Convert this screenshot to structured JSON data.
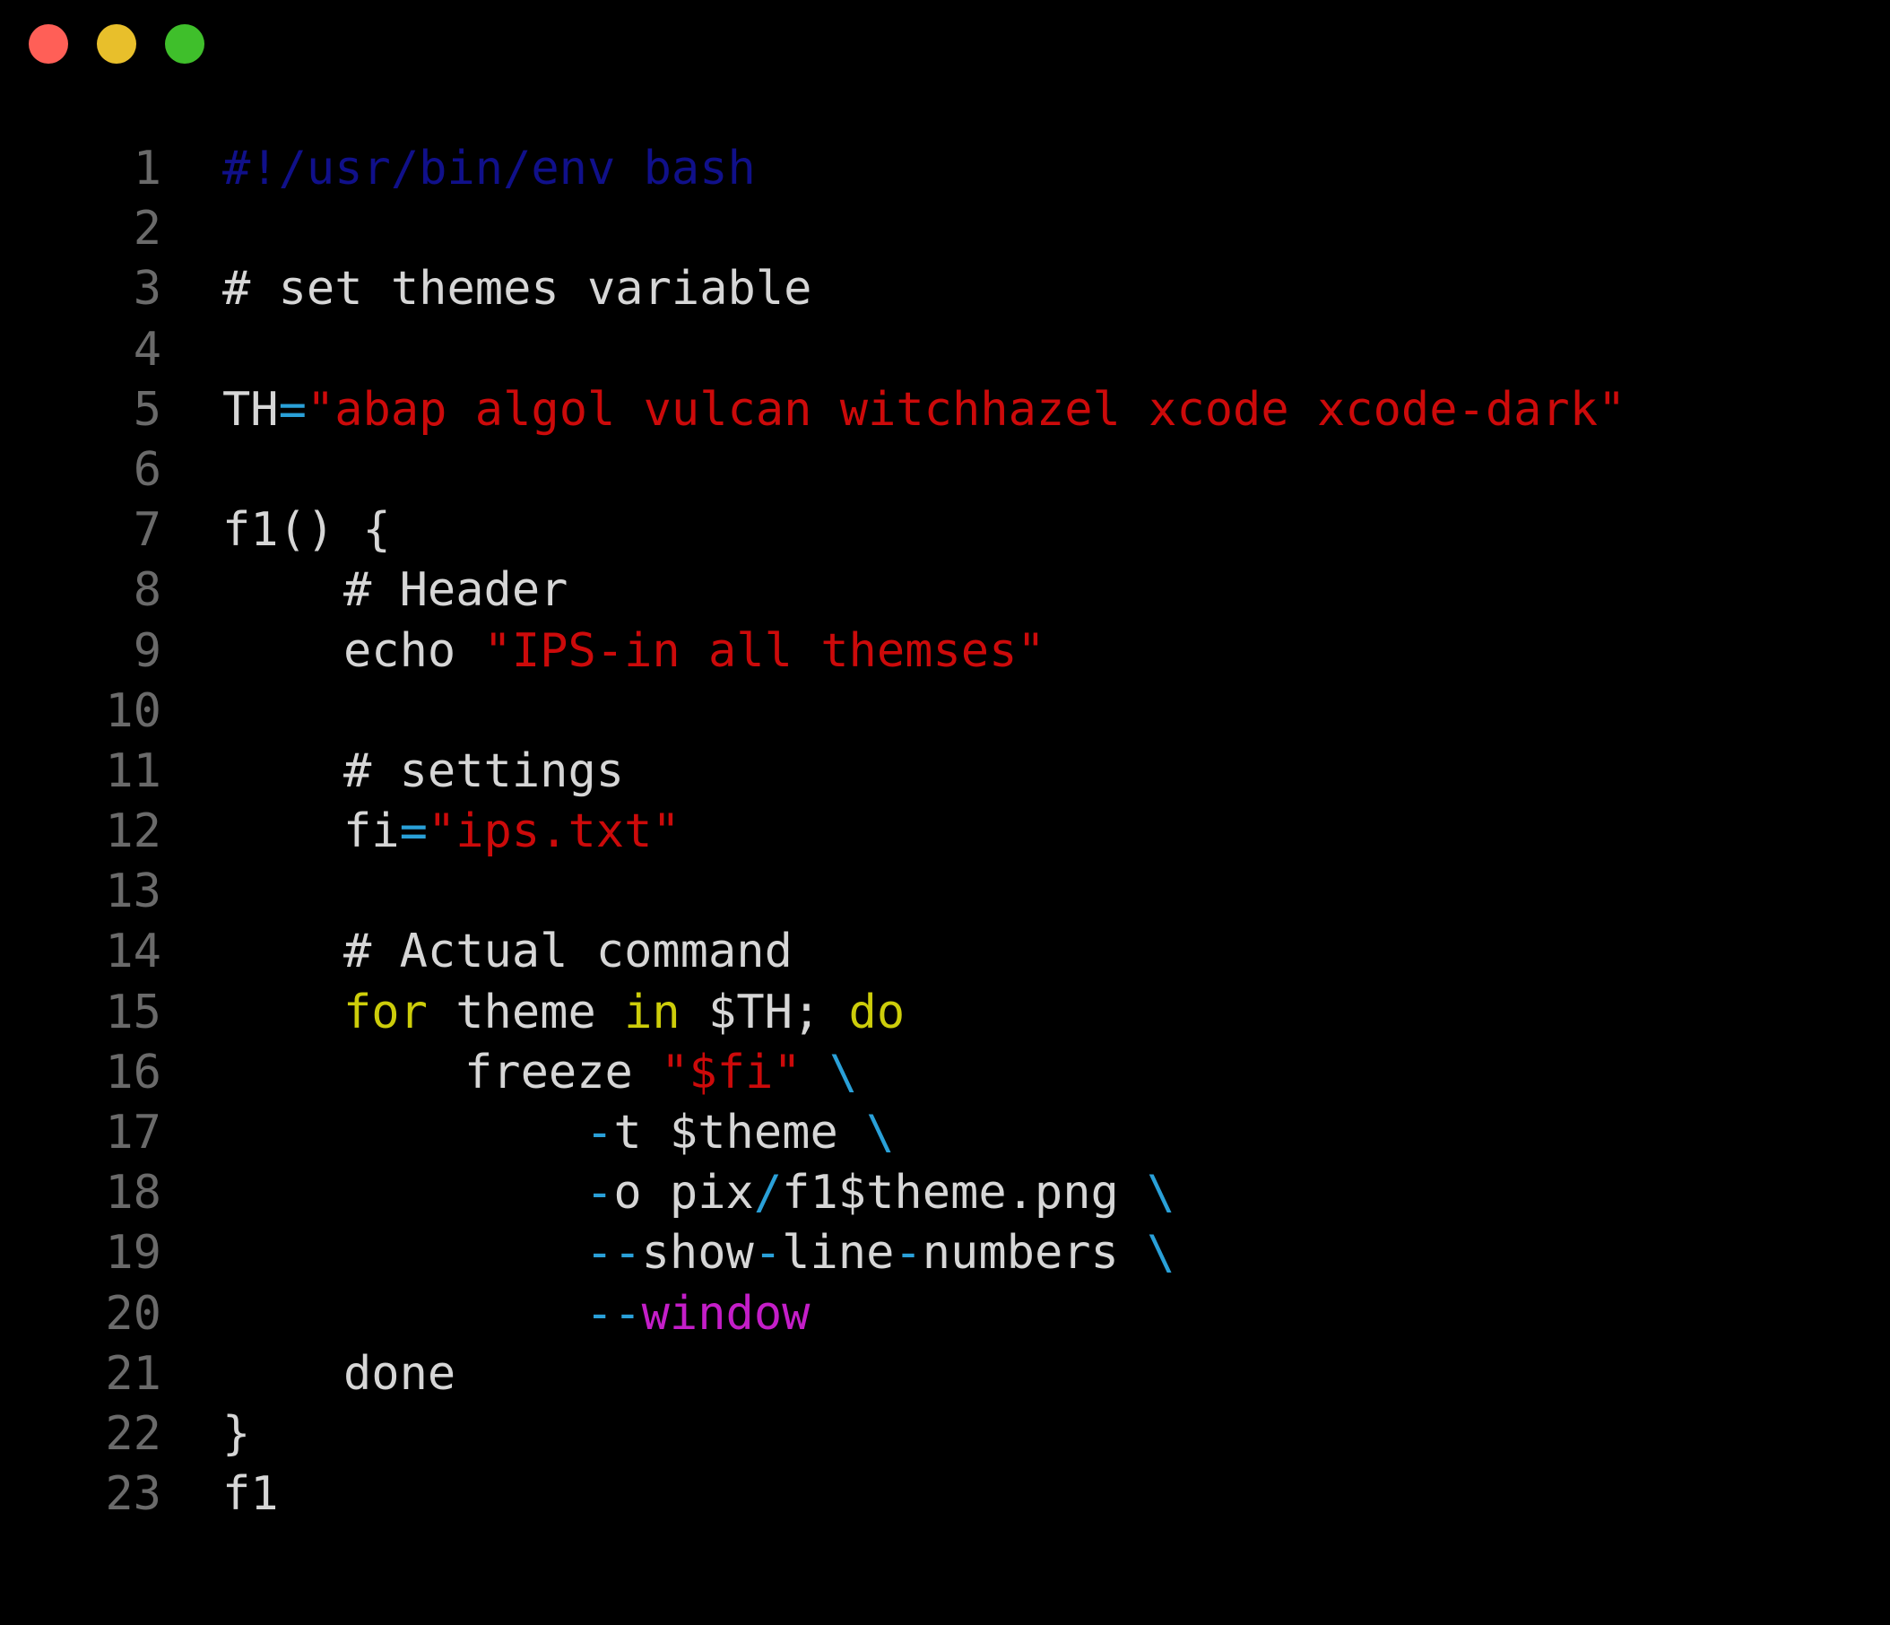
{
  "window": {
    "controls": [
      {
        "name": "close",
        "color": "#ff5f57"
      },
      {
        "name": "minimize",
        "color": "#e8bf2b"
      },
      {
        "name": "maximize",
        "color": "#3fbf2b"
      }
    ]
  },
  "theme": {
    "background": "#000000",
    "line_number": "#6a6a6a",
    "default": "#d6d6d6",
    "comment_shebang": "#10108a",
    "string": "#cc0a0a",
    "operator": "#2aa0d8",
    "keyword": "#cdcd0a",
    "option": "#c41ec8"
  },
  "lines": [
    {
      "n": "1",
      "indent": 0,
      "tokens": [
        {
          "t": "#!/usr/bin/env bash",
          "c": "comment_shebang"
        }
      ]
    },
    {
      "n": "2",
      "indent": 0,
      "tokens": []
    },
    {
      "n": "3",
      "indent": 0,
      "tokens": [
        {
          "t": "# set themes variable",
          "c": "default"
        }
      ]
    },
    {
      "n": "4",
      "indent": 0,
      "tokens": []
    },
    {
      "n": "5",
      "indent": 0,
      "tokens": [
        {
          "t": "TH",
          "c": "default"
        },
        {
          "t": "=",
          "c": "operator"
        },
        {
          "t": "\"abap algol vulcan witchhazel xcode xcode-dark\"",
          "c": "string"
        }
      ]
    },
    {
      "n": "6",
      "indent": 0,
      "tokens": []
    },
    {
      "n": "7",
      "indent": 0,
      "tokens": [
        {
          "t": "f1() {",
          "c": "default"
        }
      ]
    },
    {
      "n": "8",
      "indent": 1,
      "tokens": [
        {
          "t": "# Header",
          "c": "default"
        }
      ]
    },
    {
      "n": "9",
      "indent": 1,
      "tokens": [
        {
          "t": "echo ",
          "c": "default"
        },
        {
          "t": "\"IPS-in all themses\"",
          "c": "string"
        }
      ]
    },
    {
      "n": "10",
      "indent": 0,
      "tokens": []
    },
    {
      "n": "11",
      "indent": 1,
      "tokens": [
        {
          "t": "# settings",
          "c": "default"
        }
      ]
    },
    {
      "n": "12",
      "indent": 1,
      "tokens": [
        {
          "t": "fi",
          "c": "default"
        },
        {
          "t": "=",
          "c": "operator"
        },
        {
          "t": "\"ips.txt\"",
          "c": "string"
        }
      ]
    },
    {
      "n": "13",
      "indent": 0,
      "tokens": []
    },
    {
      "n": "14",
      "indent": 1,
      "tokens": [
        {
          "t": "# Actual command",
          "c": "default"
        }
      ]
    },
    {
      "n": "15",
      "indent": 1,
      "tokens": [
        {
          "t": "for",
          "c": "keyword"
        },
        {
          "t": " theme ",
          "c": "default"
        },
        {
          "t": "in",
          "c": "keyword"
        },
        {
          "t": " $TH; ",
          "c": "default"
        },
        {
          "t": "do",
          "c": "keyword"
        }
      ]
    },
    {
      "n": "16",
      "indent": 2,
      "tokens": [
        {
          "t": "freeze ",
          "c": "default"
        },
        {
          "t": "\"$fi\"",
          "c": "string"
        },
        {
          "t": " ",
          "c": "default"
        },
        {
          "t": "\\",
          "c": "operator"
        }
      ]
    },
    {
      "n": "17",
      "indent": 3,
      "tokens": [
        {
          "t": "-",
          "c": "operator"
        },
        {
          "t": "t $theme ",
          "c": "default"
        },
        {
          "t": "\\",
          "c": "operator"
        }
      ]
    },
    {
      "n": "18",
      "indent": 3,
      "tokens": [
        {
          "t": "-",
          "c": "operator"
        },
        {
          "t": "o pix",
          "c": "default"
        },
        {
          "t": "/",
          "c": "operator"
        },
        {
          "t": "f1$theme.png ",
          "c": "default"
        },
        {
          "t": "\\",
          "c": "operator"
        }
      ]
    },
    {
      "n": "19",
      "indent": 3,
      "tokens": [
        {
          "t": "--",
          "c": "operator"
        },
        {
          "t": "show",
          "c": "default"
        },
        {
          "t": "-",
          "c": "operator"
        },
        {
          "t": "line",
          "c": "default"
        },
        {
          "t": "-",
          "c": "operator"
        },
        {
          "t": "numbers ",
          "c": "default"
        },
        {
          "t": "\\",
          "c": "operator"
        }
      ]
    },
    {
      "n": "20",
      "indent": 3,
      "tokens": [
        {
          "t": "--",
          "c": "operator"
        },
        {
          "t": "window",
          "c": "option"
        }
      ]
    },
    {
      "n": "21",
      "indent": 1,
      "tokens": [
        {
          "t": "done",
          "c": "default"
        }
      ]
    },
    {
      "n": "22",
      "indent": 0,
      "tokens": [
        {
          "t": "}",
          "c": "default"
        }
      ]
    },
    {
      "n": "23",
      "indent": 0,
      "tokens": [
        {
          "t": "f1",
          "c": "default"
        }
      ]
    }
  ]
}
